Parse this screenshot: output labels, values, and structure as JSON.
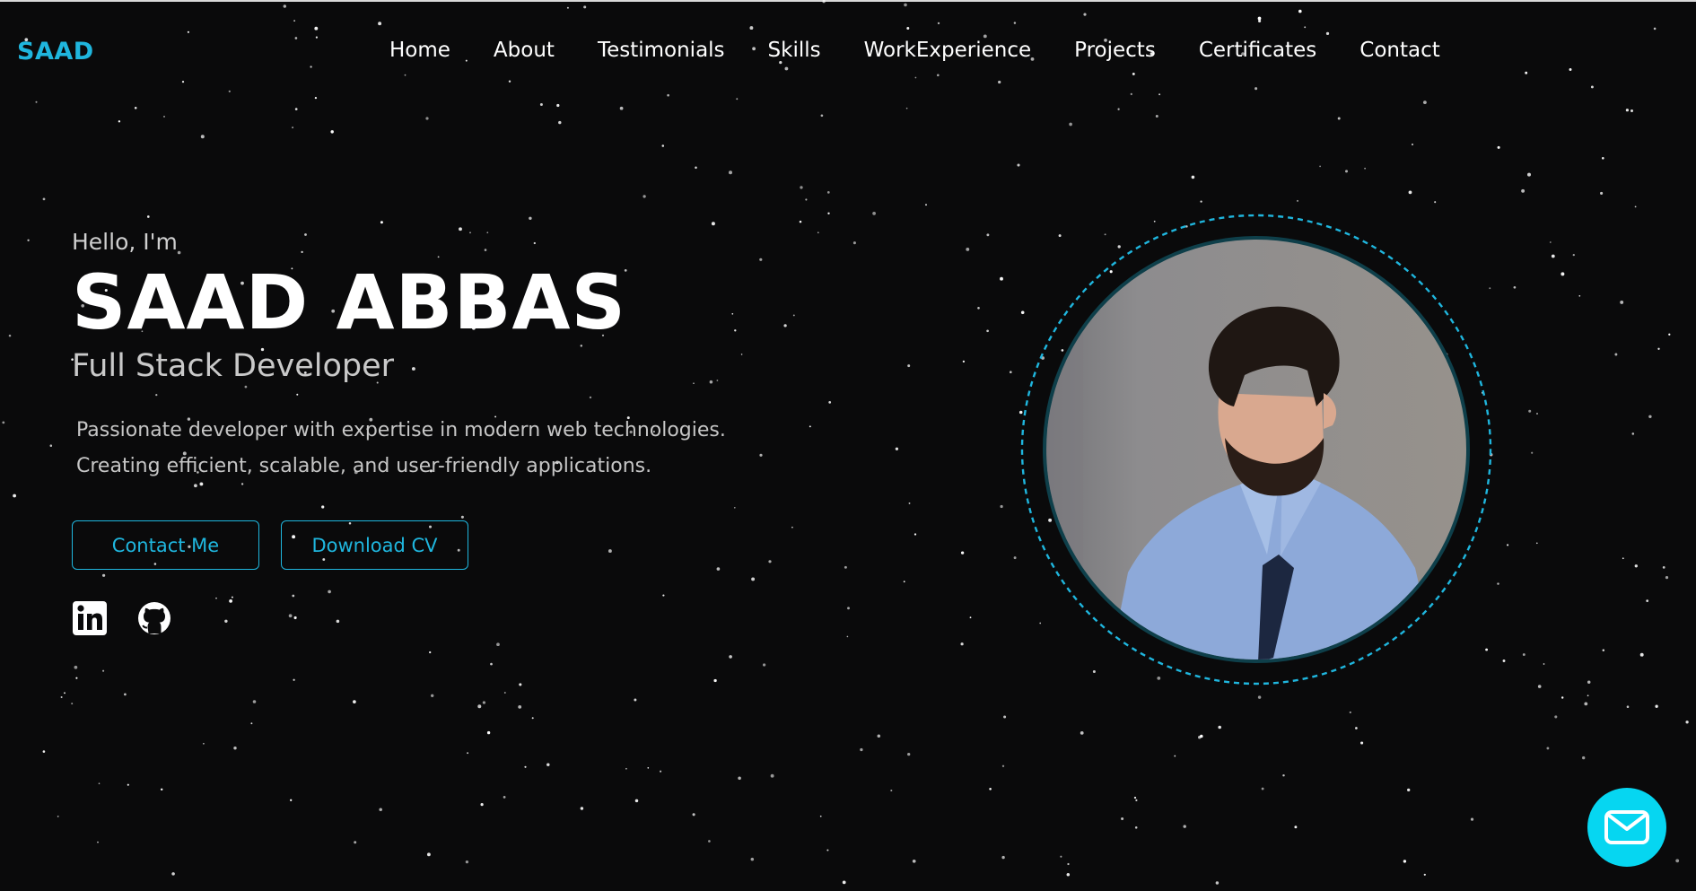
{
  "nav": {
    "logo": "SAAD",
    "items": [
      {
        "label": "Home"
      },
      {
        "label": "About"
      },
      {
        "label": "Testimonials"
      },
      {
        "label": "Skills"
      },
      {
        "label": "WorkExperience"
      },
      {
        "label": "Projects"
      },
      {
        "label": "Certificates"
      },
      {
        "label": "Contact"
      }
    ]
  },
  "hero": {
    "greeting": "Hello, I'm",
    "name": "SAAD ABBAS",
    "role": "Full Stack Developer",
    "description": "Passionate developer with expertise in modern web technologies. Creating efficient, scalable, and user-friendly applications.",
    "buttons": {
      "contact": "Contact Me",
      "cv": "Download CV"
    },
    "socials": [
      "linkedin-icon",
      "github-icon"
    ]
  },
  "floating": {
    "icon": "mail-icon"
  },
  "colors": {
    "background": "#0a0a0b",
    "accent": "#1fb6de",
    "float_button": "#06d6f1",
    "ring": "#0e3f4a"
  }
}
